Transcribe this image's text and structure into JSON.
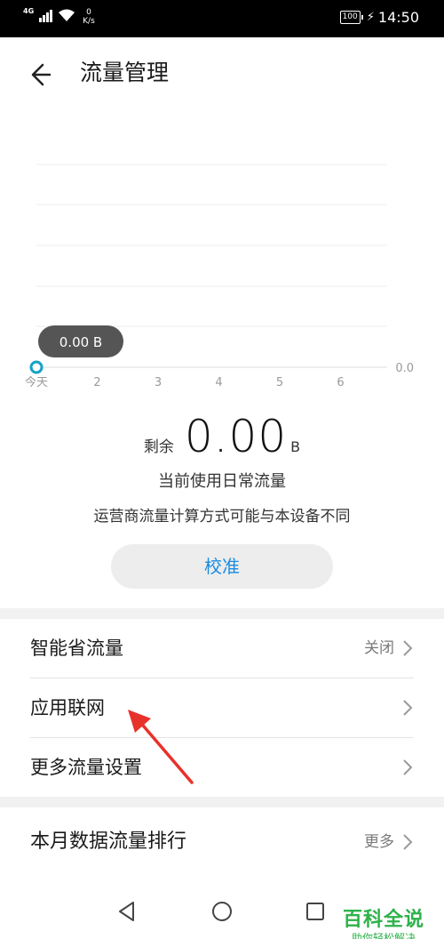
{
  "status_bar": {
    "network_type": "4G",
    "speed_value": "0",
    "speed_unit": "K/s",
    "battery": "100",
    "time": "14:50"
  },
  "header": {
    "title": "流量管理"
  },
  "chart_data": {
    "type": "line",
    "categories": [
      "今天",
      "2",
      "3",
      "4",
      "5",
      "6"
    ],
    "series": [
      {
        "values": [
          0.0
        ]
      }
    ],
    "y_axis_label": "0.0",
    "tooltip": "0.00 B",
    "grid": true
  },
  "usage": {
    "remaining_label": "剩余",
    "remaining_value": "0.00",
    "remaining_unit": "B",
    "info_line1": "当前使用日常流量",
    "info_line2": "运营商流量计算方式可能与本设备不同",
    "calibrate_label": "校准"
  },
  "settings_list": [
    {
      "label": "智能省流量",
      "value": "关闭"
    },
    {
      "label": "应用联网",
      "value": ""
    },
    {
      "label": "更多流量设置",
      "value": ""
    }
  ],
  "ranking": {
    "label": "本月数据流量排行",
    "value": "更多"
  },
  "watermark": {
    "title": "百科全说",
    "subtitle": "助你轻松解决"
  },
  "colors": {
    "accent": "#1a8be0",
    "chart_point": "#15a2c6",
    "tooltip_bg": "#555555",
    "annotation_arrow": "#e8312a",
    "watermark": "#2db24a"
  }
}
